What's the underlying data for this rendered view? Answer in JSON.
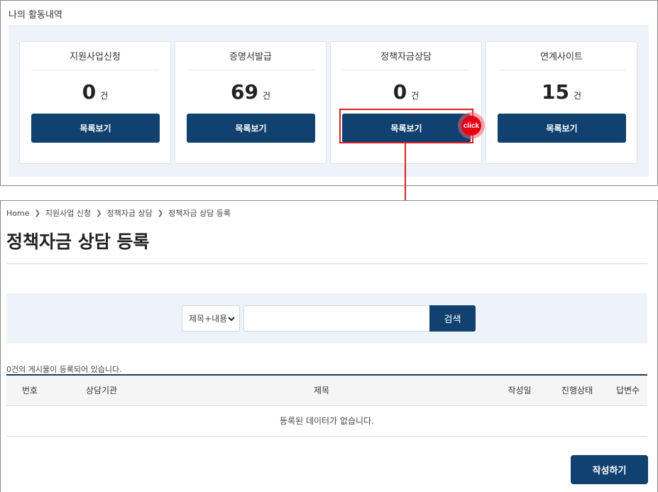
{
  "activity": {
    "title": "나의 활동내역",
    "cards": [
      {
        "title": "지원사업신청",
        "count": "0",
        "unit": "건",
        "button": "목록보기"
      },
      {
        "title": "증명서발급",
        "count": "69",
        "unit": "건",
        "button": "목록보기"
      },
      {
        "title": "정책자금상담",
        "count": "0",
        "unit": "건",
        "button": "목록보기"
      },
      {
        "title": "연계사이트",
        "count": "15",
        "unit": "건",
        "button": "목록보기"
      }
    ],
    "click_label": "click"
  },
  "breadcrumb": [
    "Home",
    "지원사업 신청",
    "정책자금 상담",
    "정책자금 상담 등록"
  ],
  "page_title": "정책자금 상담 등록",
  "search": {
    "select_value": "제목+내용",
    "input_value": "",
    "button": "검색"
  },
  "count_text": "0건의 게시물이 등록되어 있습니다.",
  "table": {
    "headers": [
      "번호",
      "상담기관",
      "제목",
      "작성일",
      "진행상태",
      "답변수"
    ],
    "empty_message": "등록된 데이터가 없습니다."
  },
  "write_button": "작성하기",
  "colors": {
    "primary": "#11416f",
    "highlight": "#d81f26",
    "panel_bg": "#eef3fa"
  }
}
